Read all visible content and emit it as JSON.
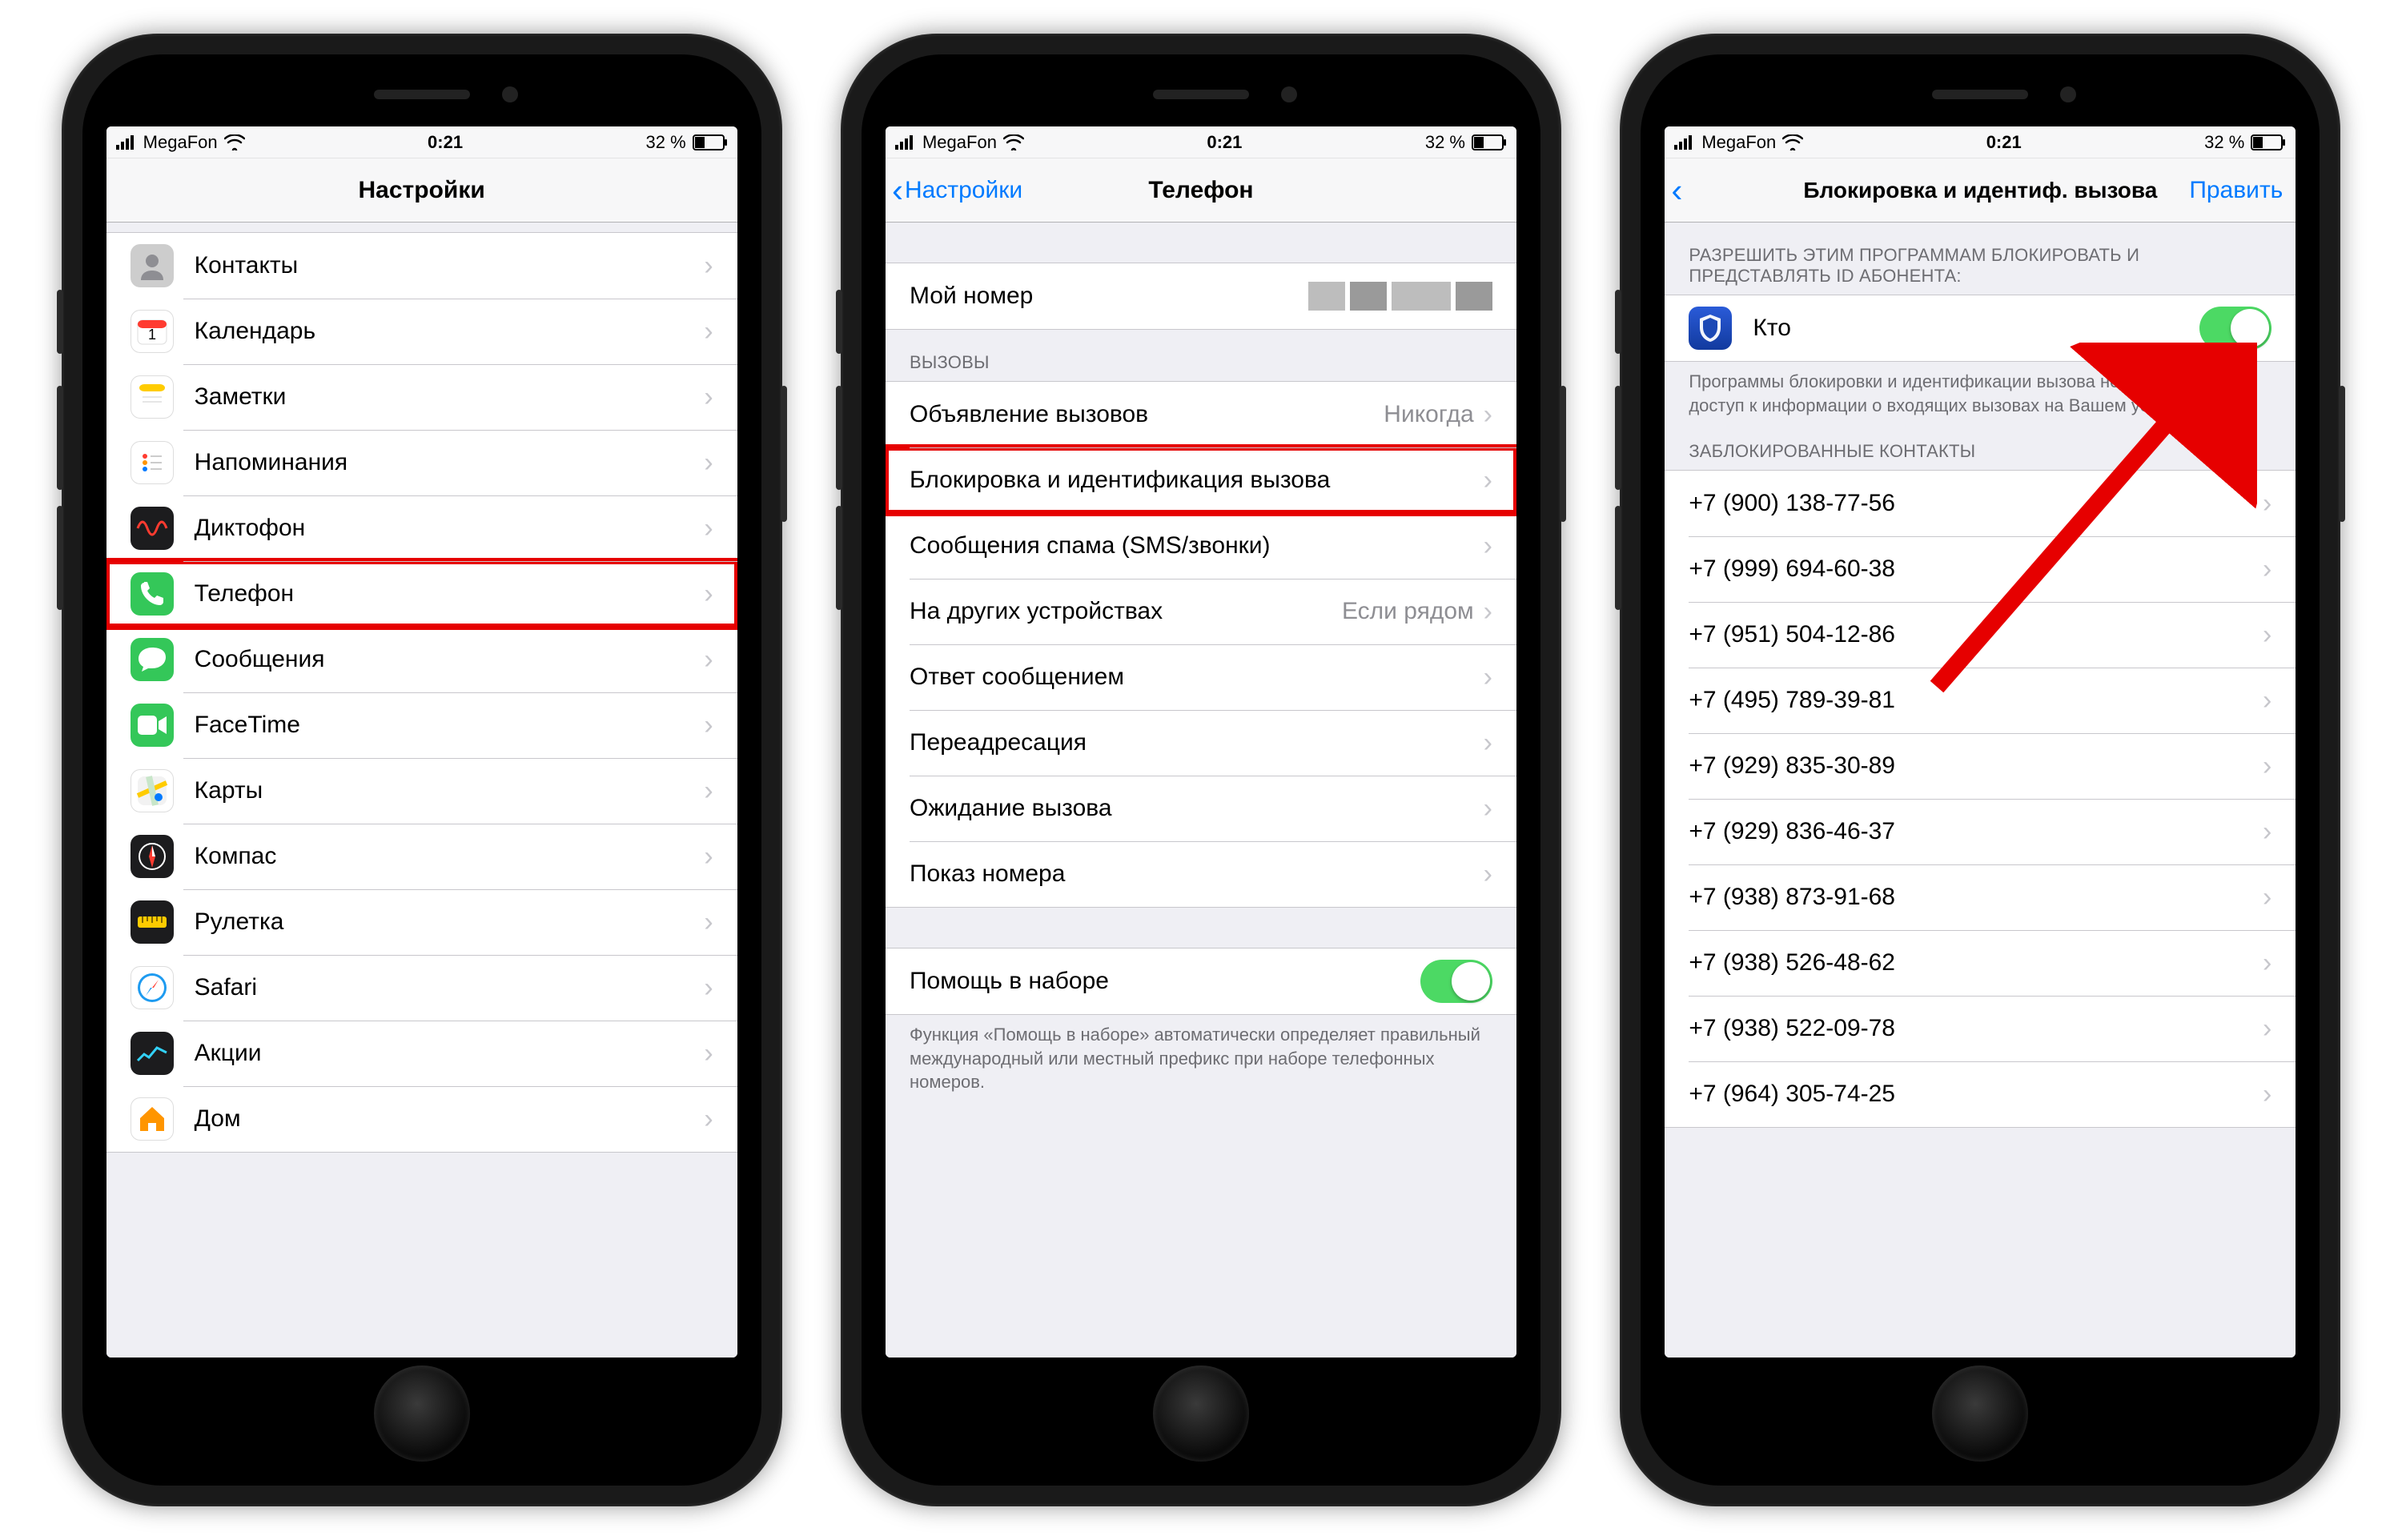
{
  "status": {
    "carrier": "MegaFon",
    "time": "0:21",
    "battery": "32 %"
  },
  "phone1": {
    "title": "Настройки",
    "items": [
      {
        "label": "Контакты",
        "icon": "contacts",
        "color": "#cdcdcd"
      },
      {
        "label": "Календарь",
        "icon": "calendar",
        "color": "#ffffff"
      },
      {
        "label": "Заметки",
        "icon": "notes",
        "color": "#ffffff"
      },
      {
        "label": "Напоминания",
        "icon": "reminders",
        "color": "#ffffff"
      },
      {
        "label": "Диктофон",
        "icon": "voice-memos",
        "color": "#1c1c1e"
      },
      {
        "label": "Телефон",
        "icon": "phone",
        "color": "#34c759",
        "highlight": true
      },
      {
        "label": "Сообщения",
        "icon": "messages",
        "color": "#34c759"
      },
      {
        "label": "FaceTime",
        "icon": "facetime",
        "color": "#34c759"
      },
      {
        "label": "Карты",
        "icon": "maps",
        "color": "#ffffff"
      },
      {
        "label": "Компас",
        "icon": "compass",
        "color": "#1c1c1e"
      },
      {
        "label": "Рулетка",
        "icon": "measure",
        "color": "#1c1c1e"
      },
      {
        "label": "Safari",
        "icon": "safari",
        "color": "#ffffff"
      },
      {
        "label": "Акции",
        "icon": "stocks",
        "color": "#1c1c1e"
      },
      {
        "label": "Дом",
        "icon": "home",
        "color": "#ffffff"
      }
    ]
  },
  "phone2": {
    "back": "Настройки",
    "title": "Телефон",
    "my_number_label": "Мой номер",
    "section_calls": "ВЫЗОВЫ",
    "rows": {
      "announce": {
        "label": "Объявление вызовов",
        "detail": "Никогда"
      },
      "blocking": {
        "label": "Блокировка и идентификация вызова",
        "highlight": true
      },
      "spam": {
        "label": "Сообщения спама (SMS/звонки)"
      },
      "other_devices": {
        "label": "На других устройствах",
        "detail": "Если рядом"
      },
      "reply": {
        "label": "Ответ сообщением"
      },
      "forwarding": {
        "label": "Переадресация"
      },
      "waiting": {
        "label": "Ожидание вызова"
      },
      "caller_id": {
        "label": "Показ номера"
      }
    },
    "dial_assist": {
      "label": "Помощь в наборе"
    },
    "dial_assist_footer": "Функция «Помощь в наборе» автоматически определяет правильный международный или местный префикс при наборе телефонных номеров."
  },
  "phone3": {
    "title": "Блокировка и идентиф. вызова",
    "edit": "Править",
    "allow_header": "РАЗРЕШИТЬ ЭТИМ ПРОГРАММАМ БЛОКИРОВАТЬ И ПРЕДСТАВЛЯТЬ ID АБОНЕНТА:",
    "app": {
      "label": "Кто"
    },
    "allow_footer": "Программы блокировки и идентификации вызова не могут получить доступ к информации о входящих вызовах на Вашем устройстве.",
    "blocked_header": "ЗАБЛОКИРОВАННЫЕ КОНТАКТЫ",
    "blocked": [
      "+7 (900) 138-77-56",
      "+7 (999) 694-60-38",
      "+7 (951) 504-12-86",
      "+7 (495) 789-39-81",
      "+7 (929) 835-30-89",
      "+7 (929) 836-46-37",
      "+7 (938) 873-91-68",
      "+7 (938) 526-48-62",
      "+7 (938) 522-09-78",
      "+7 (964) 305-74-25"
    ]
  }
}
